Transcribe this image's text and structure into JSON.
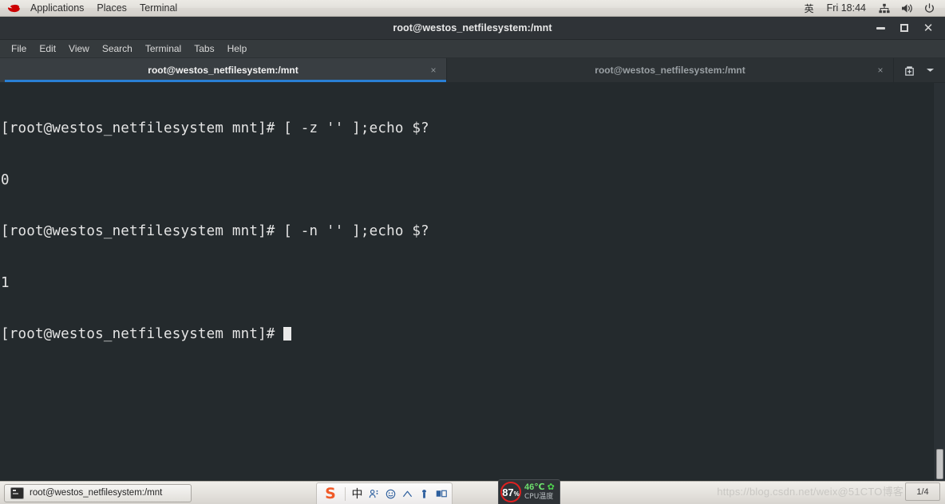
{
  "desktop": {
    "top_panel": {
      "logo": "redhat-logo",
      "menus": [
        {
          "label": "Applications",
          "name": "applications-menu"
        },
        {
          "label": "Places",
          "name": "places-menu"
        },
        {
          "label": "Terminal",
          "name": "terminal-menu"
        }
      ],
      "tray": {
        "ime_indicator": "英",
        "clock": "Fri 18:44",
        "network_icon": "network-icon",
        "volume_icon": "volume-icon",
        "power_icon": "power-icon"
      }
    },
    "taskbar": {
      "window_button": "root@westos_netfilesystem:/mnt",
      "ime": {
        "logo": "S",
        "mode": "中",
        "icons": [
          "person-icon",
          "smiley-icon",
          "cloud-icon",
          "tool-icon",
          "keyboard-icon"
        ]
      },
      "cpu_widget": {
        "usage": "87",
        "usage_unit": "%",
        "temperature": "46℃",
        "leaf_icon": "leaf-icon",
        "caption": "CPU温度"
      },
      "watermark": "https://blog.csdn.net/weix@51CTO博客",
      "workspace": "1/4"
    }
  },
  "window": {
    "title": "root@westos_netfilesystem:/mnt",
    "controls": {
      "minimize": "minimize-button",
      "maximize": "maximize-button",
      "close": "close-button"
    },
    "menu_bar": [
      {
        "label": "File",
        "name": "menu-file"
      },
      {
        "label": "Edit",
        "name": "menu-edit"
      },
      {
        "label": "View",
        "name": "menu-view"
      },
      {
        "label": "Search",
        "name": "menu-search"
      },
      {
        "label": "Terminal",
        "name": "menu-terminal"
      },
      {
        "label": "Tabs",
        "name": "menu-tabs"
      },
      {
        "label": "Help",
        "name": "menu-help"
      }
    ],
    "tabs": [
      {
        "label": "root@westos_netfilesystem:/mnt",
        "active": true,
        "close": "×"
      },
      {
        "label": "root@westos_netfilesystem:/mnt",
        "active": false,
        "close": "×"
      }
    ],
    "tab_actions": {
      "new_tab": "new-tab-button",
      "tab_menu": "tab-list-dropdown"
    }
  },
  "terminal": {
    "lines": [
      "[root@westos_netfilesystem mnt]# [ -z '' ];echo $?",
      "0",
      "[root@westos_netfilesystem mnt]# [ -n '' ];echo $?",
      "1"
    ],
    "prompt": "[root@westos_netfilesystem mnt]# ",
    "colors": {
      "background": "#242a2d",
      "foreground": "#e4e4e4",
      "accent": "#2a7fd4"
    }
  }
}
